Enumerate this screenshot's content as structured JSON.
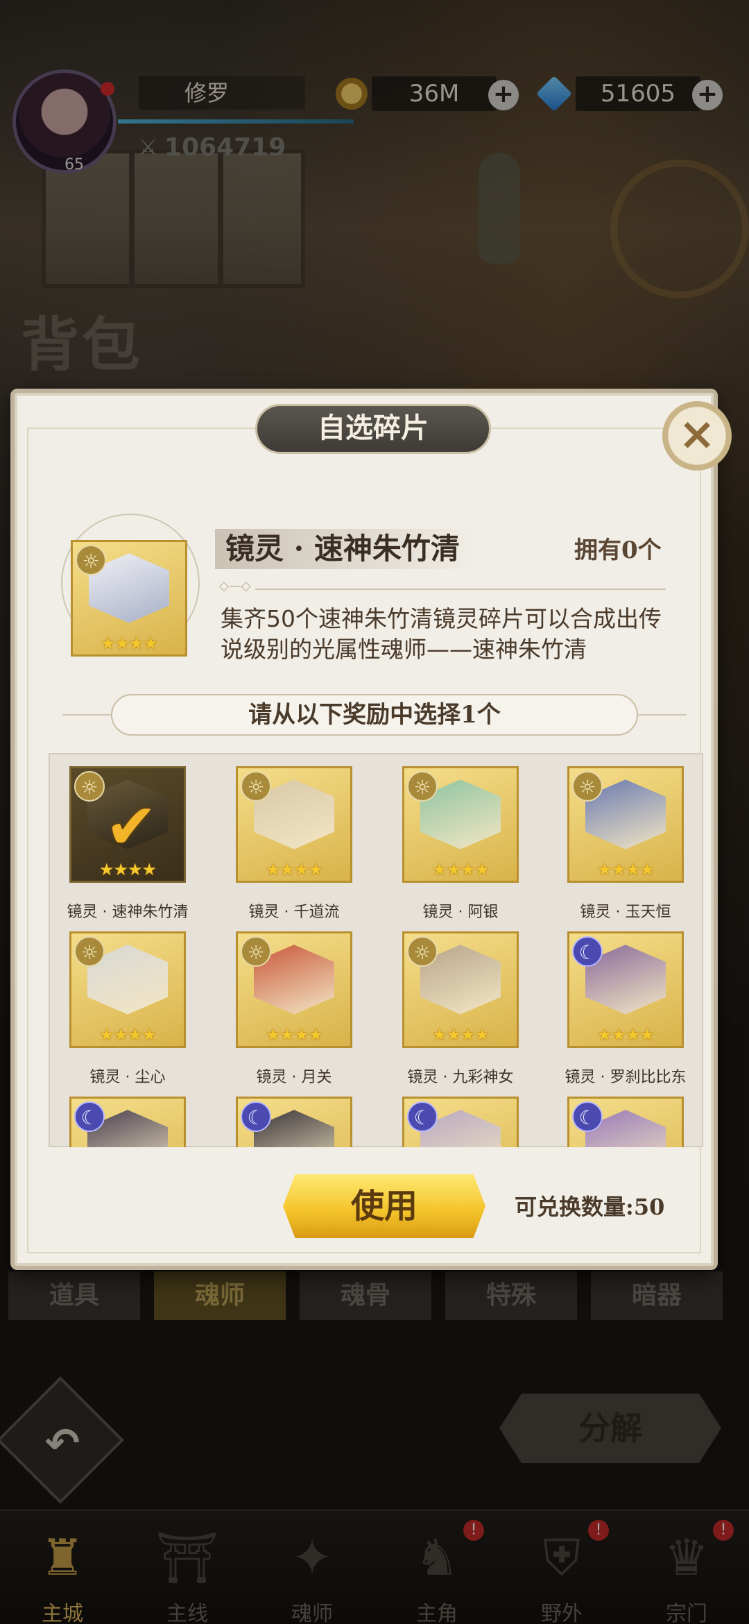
{
  "player": {
    "name": "修罗",
    "level": "65",
    "power": "1064719",
    "gold": "36M",
    "diamonds": "51605"
  },
  "background": {
    "section_title": "背包"
  },
  "modal": {
    "title": "自选碎片",
    "close_icon": "×",
    "hero": {
      "name": "镜灵 · 速神朱竹清",
      "owned": "拥有0个",
      "description": "集齐50个速神朱竹清镜灵碎片可以合成出传说级别的光属性魂师——速神朱竹清",
      "stars": "★★★★"
    },
    "select_prompt": "请从以下奖励中选择1个",
    "rewards": [
      {
        "label": "镜灵 · 速神朱竹清",
        "attr": "sun",
        "selected": true,
        "stars": "★★★★",
        "color": "#6a5a3a"
      },
      {
        "label": "镜灵 · 千道流",
        "attr": "sun",
        "selected": false,
        "stars": "★★★★",
        "color": "#d8c8a8"
      },
      {
        "label": "镜灵 · 阿银",
        "attr": "sun",
        "selected": false,
        "stars": "★★★★",
        "color": "#8fc4a0"
      },
      {
        "label": "镜灵 · 玉天恒",
        "attr": "sun",
        "selected": false,
        "stars": "★★★★",
        "color": "#6a7ab0"
      },
      {
        "label": "镜灵 · 尘心",
        "attr": "sun",
        "selected": false,
        "stars": "★★★★",
        "color": "#d8d8d4"
      },
      {
        "label": "镜灵 · 月关",
        "attr": "sun",
        "selected": false,
        "stars": "★★★★",
        "color": "#c8583a"
      },
      {
        "label": "镜灵 · 九彩神女",
        "attr": "sun",
        "selected": false,
        "stars": "★★★★",
        "color": "#b8a58c"
      },
      {
        "label": "镜灵 · 罗刹比比东",
        "attr": "moon",
        "selected": false,
        "stars": "★★★★",
        "color": "#8a6a9a"
      },
      {
        "label": "",
        "attr": "moon",
        "selected": false,
        "stars": "",
        "color": "#4a4050"
      },
      {
        "label": "",
        "attr": "moon",
        "selected": false,
        "stars": "",
        "color": "#3a3438"
      },
      {
        "label": "",
        "attr": "moon",
        "selected": false,
        "stars": "",
        "color": "#b8a8c0"
      },
      {
        "label": "",
        "attr": "moon",
        "selected": false,
        "stars": "",
        "color": "#9a7ab8"
      }
    ],
    "use_button": "使用",
    "exchange_count": "可兑换数量:50"
  },
  "categories": [
    {
      "label": "道具",
      "active": false
    },
    {
      "label": "魂师",
      "active": true
    },
    {
      "label": "魂骨",
      "active": false
    },
    {
      "label": "特殊",
      "active": false
    },
    {
      "label": "暗器",
      "active": false
    }
  ],
  "decompose_button": "分解",
  "back_icon": "↶",
  "nav": [
    {
      "label": "主城",
      "icon": "castle-icon",
      "glyph": "♜",
      "active": true,
      "badge": ""
    },
    {
      "label": "主线",
      "icon": "gate-icon",
      "glyph": "⛩",
      "active": false,
      "badge": ""
    },
    {
      "label": "魂师",
      "icon": "book-icon",
      "glyph": "✦",
      "active": false,
      "badge": ""
    },
    {
      "label": "主角",
      "icon": "hero-icon",
      "glyph": "♞",
      "active": false,
      "badge": "!"
    },
    {
      "label": "野外",
      "icon": "shield-icon",
      "glyph": "⛨",
      "active": false,
      "badge": "!"
    },
    {
      "label": "宗门",
      "icon": "crest-icon",
      "glyph": "♛",
      "active": false,
      "badge": "!"
    }
  ],
  "colors": {
    "gold_accent": "#f3c228",
    "panel": "#f1eee7",
    "badge_red": "#c42a2a"
  }
}
